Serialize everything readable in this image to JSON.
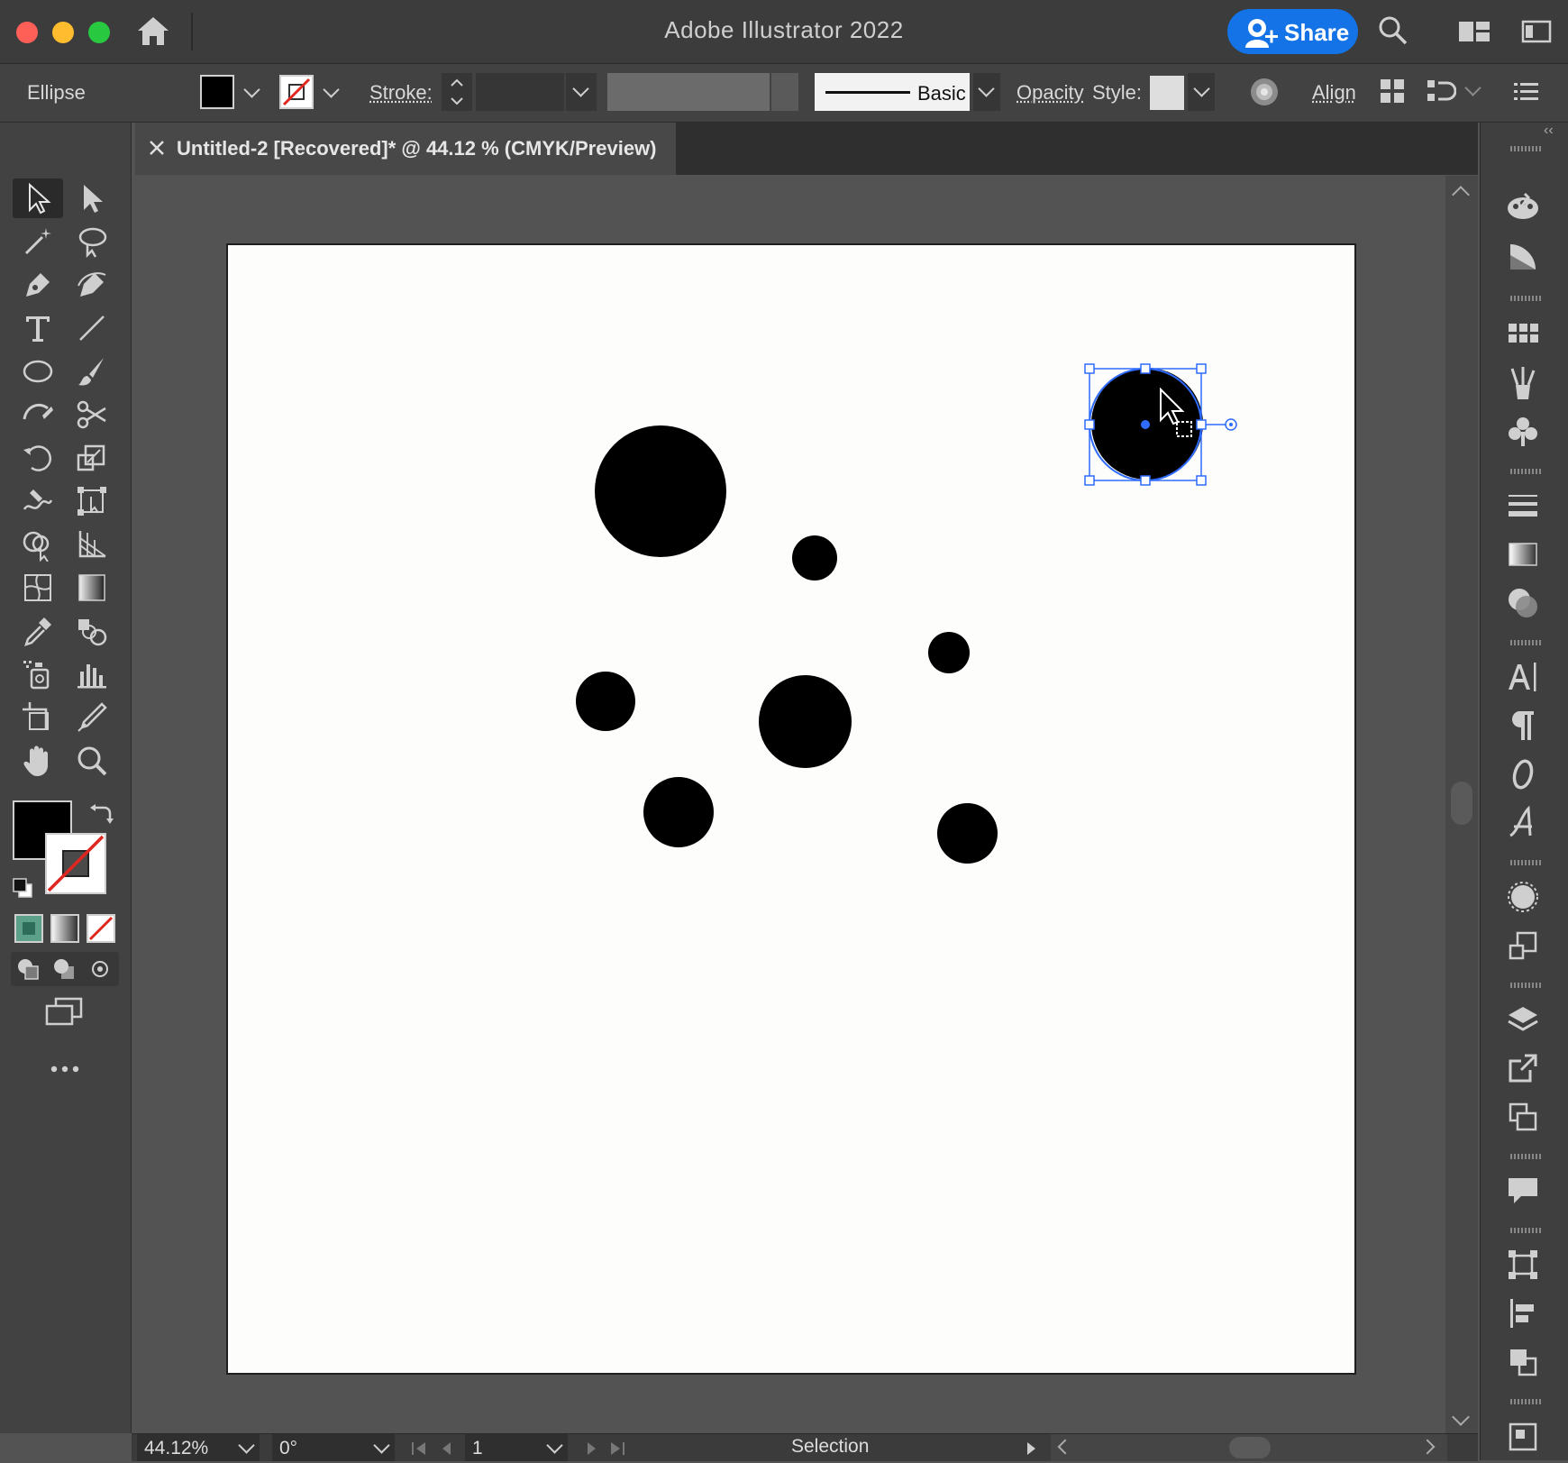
{
  "app": {
    "title": "Adobe Illustrator 2022",
    "share_label": "Share"
  },
  "controlbar": {
    "object_type": "Ellipse",
    "stroke_label": "Stroke:",
    "brush_preset": "Basic",
    "opacity_label": "Opacity",
    "style_label": "Style:",
    "align_label": "Align"
  },
  "document": {
    "tab_title": "Untitled-2 [Recovered]* @ 44.12 % (CMYK/Preview)"
  },
  "statusbar": {
    "zoom": "44.12%",
    "rotation": "0°",
    "artboard_number": "1",
    "current_tool": "Selection"
  },
  "colors": {
    "accent": "#1473e6",
    "selection": "#2f6bff",
    "fill": "#000000",
    "stroke": "none"
  },
  "icons": [
    "home-icon",
    "search-icon",
    "arrange-documents-icon",
    "panel-toggle-icon",
    "selection-tool-icon",
    "direct-selection-tool-icon",
    "magic-wand-icon",
    "lasso-icon",
    "pen-icon",
    "curvature-icon",
    "type-icon",
    "line-icon",
    "ellipse-icon",
    "paintbrush-icon",
    "shaper-icon",
    "scissors-icon",
    "rotate-icon",
    "scale-icon",
    "warp-icon",
    "free-transform-icon",
    "shape-builder-icon",
    "perspective-icon",
    "mesh-icon",
    "gradient-icon",
    "eyedropper-icon",
    "blend-icon",
    "symbol-sprayer-icon",
    "graph-icon",
    "artboard-icon",
    "slice-icon",
    "hand-icon",
    "zoom-icon"
  ]
}
